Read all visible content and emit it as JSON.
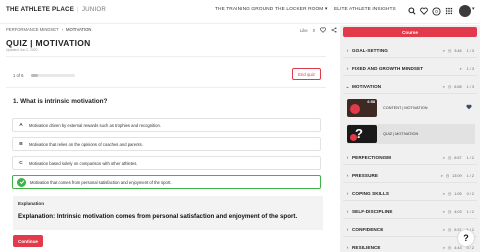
{
  "header": {
    "brand": "THE ATHLETE PLACE",
    "brand_sub": "JUNIOR",
    "nav": [
      "THE TRAINING GROUND",
      "THE LOCKER ROOM",
      "ELITE ATHLETE INSIGHTS"
    ],
    "notification_count": "0"
  },
  "breadcrumb": {
    "parent": "PERFORMANCE MINDSET",
    "current": "MOTIVATION"
  },
  "actions": {
    "like": "Like",
    "like_count": "0"
  },
  "page": {
    "title": "QUIZ | MOTIVATION",
    "updated": "Updated Jun 2, 2020"
  },
  "quiz": {
    "counter": "1 of 6",
    "progress": 0.17,
    "end_label": "End quiz",
    "question": "1. What is intrinsic motivation?",
    "options": [
      {
        "letter": "A",
        "text": "Motivation driven by external rewards such as trophies and recognition."
      },
      {
        "letter": "B",
        "text": "Motivation that relies on the opinions of coaches and parents."
      },
      {
        "letter": "C",
        "text": "Motivation based solely on comparison with other athletes."
      },
      {
        "letter": "",
        "text": "Motivation that comes from personal satisfaction and enjoyment of the sport.",
        "correct": true
      }
    ],
    "explanation_label": "Explanation",
    "explanation": "Explanation: Intrinsic motivation comes from personal satisfaction and enjoyment of the sport.",
    "continue_label": "Continue"
  },
  "sidebar": {
    "course_label": "Course",
    "sections": [
      {
        "name": "GOAL-SETTING",
        "time": "3:46",
        "count": "1 / 3",
        "expanded": false
      },
      {
        "name": "FIXED AND GROWTH MINDSET",
        "time": "",
        "count": "1 / 3",
        "expanded": false
      },
      {
        "name": "MOTIVATION",
        "time": "6:58",
        "count": "1 / 3",
        "expanded": true
      },
      {
        "name": "PERFECTIONISM",
        "time": "6:57",
        "count": "1 / 2",
        "expanded": false
      },
      {
        "name": "PRESSURE",
        "time": "13:09",
        "count": "1 / 2",
        "expanded": false
      },
      {
        "name": "COPING SKILLS",
        "time": "1:05",
        "count": "0 / 2",
        "expanded": false
      },
      {
        "name": "SELF-DISCIPLINE",
        "time": "4:03",
        "count": "1 / 2",
        "expanded": false
      },
      {
        "name": "CONFIDENCE",
        "time": "5:37",
        "count": "1 / 2",
        "expanded": false
      },
      {
        "name": "RESILIENCE",
        "time": "4:43",
        "count": "0 / 2",
        "expanded": false
      }
    ],
    "items": [
      {
        "label": "CONTENT | MOTIVATION",
        "duration": "6:58"
      },
      {
        "label": "QUIZ | MOTIVATION",
        "qmark": "?"
      }
    ]
  },
  "colors": {
    "accent": "#e23a4b",
    "correct": "#3fb24a",
    "sidebar_bg": "#f0f0f0"
  },
  "help": "?"
}
